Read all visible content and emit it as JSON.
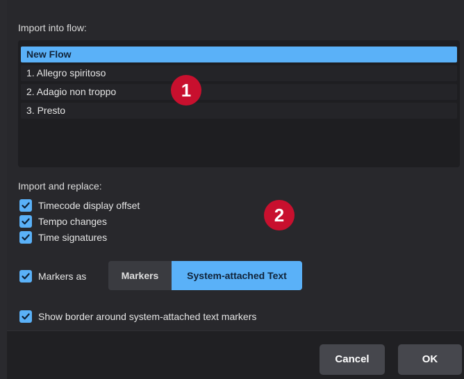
{
  "import_flow": {
    "label": "Import into flow:",
    "items": [
      {
        "label": "New Flow",
        "selected": true
      },
      {
        "label": "1. Allegro spiritoso",
        "selected": false
      },
      {
        "label": "2. Adagio non troppo",
        "selected": false
      },
      {
        "label": "3. Presto",
        "selected": false
      }
    ]
  },
  "callouts": {
    "one": "1",
    "two": "2",
    "color": "#c8102e"
  },
  "import_replace": {
    "label": "Import and replace:",
    "options": [
      {
        "label": "Timecode display offset",
        "checked": true
      },
      {
        "label": "Tempo changes",
        "checked": true
      },
      {
        "label": "Time signatures",
        "checked": true
      }
    ]
  },
  "markers": {
    "label": "Markers as",
    "checked": true,
    "options": [
      "Markers",
      "System-attached Text"
    ],
    "selected": "System-attached Text"
  },
  "border_option": {
    "label": "Show border around system-attached text markers",
    "checked": true
  },
  "footer": {
    "cancel_label": "Cancel",
    "ok_label": "OK"
  },
  "colors": {
    "accent": "#5ab1f8",
    "background": "#28282c"
  }
}
